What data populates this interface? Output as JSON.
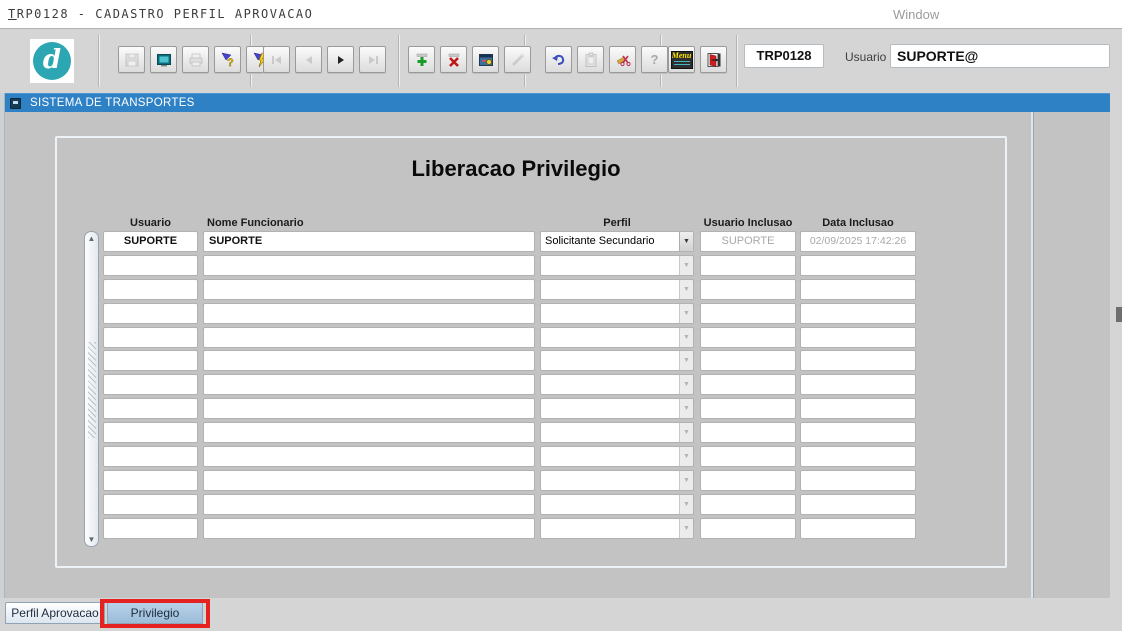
{
  "window": {
    "title": "TRP0128 - CADASTRO PERFIL APROVACAO",
    "menu": "Window"
  },
  "toolbar": {
    "logo_letter": "d",
    "program_code": "TRP0128",
    "user_label": "Usuario",
    "user_value": "SUPORTE@",
    "menu_button_label": "Menu",
    "buttons": [
      {
        "name": "save",
        "enabled": false
      },
      {
        "name": "screen",
        "enabled": true
      },
      {
        "name": "print",
        "enabled": false
      },
      {
        "name": "enter-query",
        "enabled": true
      },
      {
        "name": "execute-query",
        "enabled": true
      },
      {
        "name": "first-record",
        "enabled": false
      },
      {
        "name": "previous-record",
        "enabled": false
      },
      {
        "name": "next-record",
        "enabled": true
      },
      {
        "name": "last-record",
        "enabled": false
      },
      {
        "name": "insert-record",
        "enabled": true
      },
      {
        "name": "delete-record",
        "enabled": true
      },
      {
        "name": "edit-record",
        "enabled": true
      },
      {
        "name": "clear-record",
        "enabled": false
      },
      {
        "name": "undo",
        "enabled": true
      },
      {
        "name": "paste",
        "enabled": false
      },
      {
        "name": "cut",
        "enabled": true
      },
      {
        "name": "help",
        "enabled": false
      },
      {
        "name": "menu",
        "enabled": true
      },
      {
        "name": "exit",
        "enabled": true
      }
    ]
  },
  "header_bar": {
    "title": "SISTEMA DE TRANSPORTES"
  },
  "main": {
    "title": "Liberacao Privilegio",
    "table": {
      "columns": [
        "Usuario",
        "Nome Funcionario",
        "Perfil",
        "Usuario Inclusao",
        "Data Inclusao"
      ],
      "rows": [
        {
          "usuario": "SUPORTE",
          "nome_funcionario": "SUPORTE",
          "perfil": "Solicitante Secundario",
          "usuario_inclusao": "SUPORTE",
          "data_inclusao": "02/09/2025 17:42:26"
        }
      ],
      "empty_row_count": 12
    }
  },
  "tabs": [
    {
      "label": "Perfil Aprovacao",
      "active": false,
      "highlighted": false
    },
    {
      "label": "Privilegio",
      "active": true,
      "highlighted": true
    }
  ],
  "colors": {
    "accent_blue": "#2e81c5",
    "logo_teal": "#2ba6b2",
    "annotation_red": "#e42320",
    "active_tab": "#a9c7e6"
  }
}
